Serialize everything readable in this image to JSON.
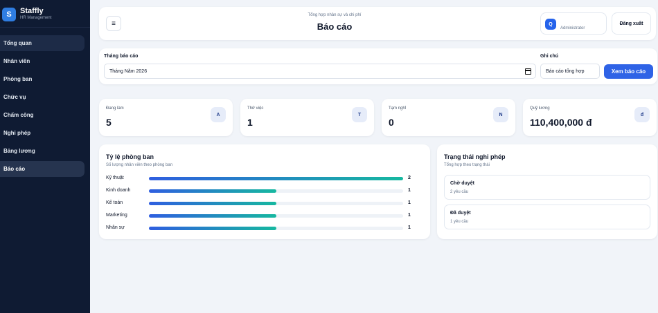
{
  "brand": {
    "logo_letter": "S",
    "name": "Staffly",
    "subtitle": "HR Management"
  },
  "sidebar": {
    "items": [
      {
        "label": "Tổng quan"
      },
      {
        "label": "Nhân viên"
      },
      {
        "label": "Phòng ban"
      },
      {
        "label": "Chức vụ"
      },
      {
        "label": "Chấm công"
      },
      {
        "label": "Nghỉ phép"
      },
      {
        "label": "Bảng lương"
      },
      {
        "label": "Báo cáo"
      }
    ]
  },
  "header": {
    "menu_icon": "≡",
    "subtitle": "Tổng hợp nhân sự và chi phí",
    "title": "Báo cáo",
    "user": {
      "avatar_letter": "Q",
      "role": "Administrator"
    },
    "logout_label": "Đăng xuất"
  },
  "filter": {
    "month_label": "Tháng báo cáo",
    "month_value": "Tháng Năm 2026",
    "note_label": "Ghi chú",
    "note_value": "Báo cáo tổng hợp",
    "submit_label": "Xem báo cáo"
  },
  "stats": [
    {
      "label": "Đang làm",
      "value": "5",
      "badge": "A"
    },
    {
      "label": "Thử việc",
      "value": "1",
      "badge": "T"
    },
    {
      "label": "Tạm nghỉ",
      "value": "0",
      "badge": "N"
    },
    {
      "label": "Quỹ lương",
      "value": "110,400,000 đ",
      "badge": "đ"
    }
  ],
  "departments": {
    "title": "Tỷ lệ phòng ban",
    "subtitle": "Số lượng nhân viên theo phòng ban",
    "rows": [
      {
        "name": "Kỹ thuật",
        "count": "2",
        "fraction": 1.0
      },
      {
        "name": "Kinh doanh",
        "count": "1",
        "fraction": 0.5
      },
      {
        "name": "Kế toán",
        "count": "1",
        "fraction": 0.5
      },
      {
        "name": "Marketing",
        "count": "1",
        "fraction": 0.5
      },
      {
        "name": "Nhân sự",
        "count": "1",
        "fraction": 0.5
      }
    ]
  },
  "leave": {
    "title": "Trạng thái nghỉ phép",
    "subtitle": "Tổng hợp theo trạng thái",
    "items": [
      {
        "status": "Chờ duyệt",
        "count": "2 yêu cầu"
      },
      {
        "status": "Đã duyệt",
        "count": "1 yêu cầu"
      }
    ]
  }
}
